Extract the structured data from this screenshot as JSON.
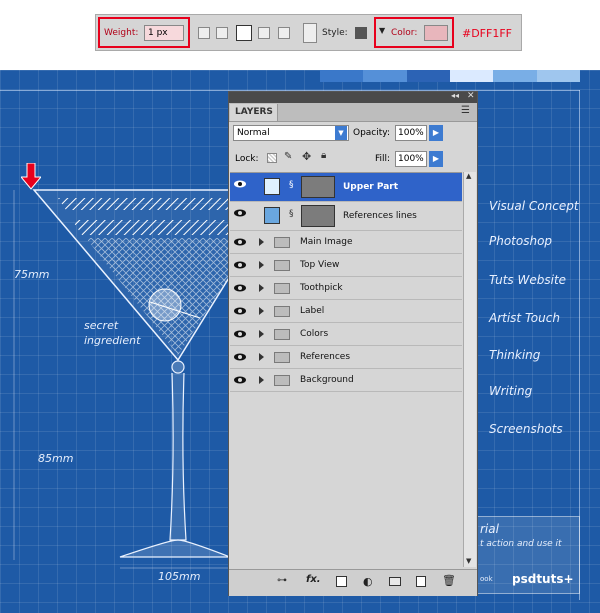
{
  "options_bar": {
    "weight_label": "Weight:",
    "weight_value": "1 px",
    "style_label": "Style:",
    "color_label": "Color:",
    "color_swatch": "#DFF1FF",
    "color_annotation": "#DFF1FF"
  },
  "blueprint": {
    "dims": {
      "top": "75mm",
      "bottom": "85mm",
      "base": "105mm"
    },
    "note": {
      "line1": "secret",
      "line2": "ingredient"
    },
    "nav": [
      "Visual Concept",
      "Photoshop",
      "Tuts Website",
      "Artist Touch",
      "Thinking",
      "Writing",
      "Screenshots"
    ],
    "tutorial": {
      "title": "rial",
      "subtitle": "t action and use it",
      "small": "ook"
    },
    "brand": "psdtuts+"
  },
  "layers_panel": {
    "title": "LAYERS",
    "blend_mode": "Normal",
    "opacity_label": "Opacity:",
    "opacity_value": "100%",
    "lock_label": "Lock:",
    "fill_label": "Fill:",
    "fill_value": "100%",
    "layers": [
      {
        "name": "Upper Part",
        "type": "layer",
        "selected": true
      },
      {
        "name": "References lines",
        "type": "layer",
        "selected": false
      },
      {
        "name": "Main Image",
        "type": "group"
      },
      {
        "name": "Top View",
        "type": "group"
      },
      {
        "name": "Toothpick",
        "type": "group"
      },
      {
        "name": "Label",
        "type": "group"
      },
      {
        "name": "Colors",
        "type": "group"
      },
      {
        "name": "References",
        "type": "group"
      },
      {
        "name": "Background",
        "type": "group"
      }
    ],
    "bottom_icons": [
      "link-icon",
      "fx-icon",
      "mask-icon",
      "adjustment-icon",
      "folder-icon",
      "new-layer-icon",
      "trash-icon"
    ]
  },
  "colors": {
    "accent_red": "#e8001c",
    "blueprint_blue": "#1e5aa6",
    "selection_blue": "#2f63c9",
    "swatch": "#e8b6bc"
  }
}
